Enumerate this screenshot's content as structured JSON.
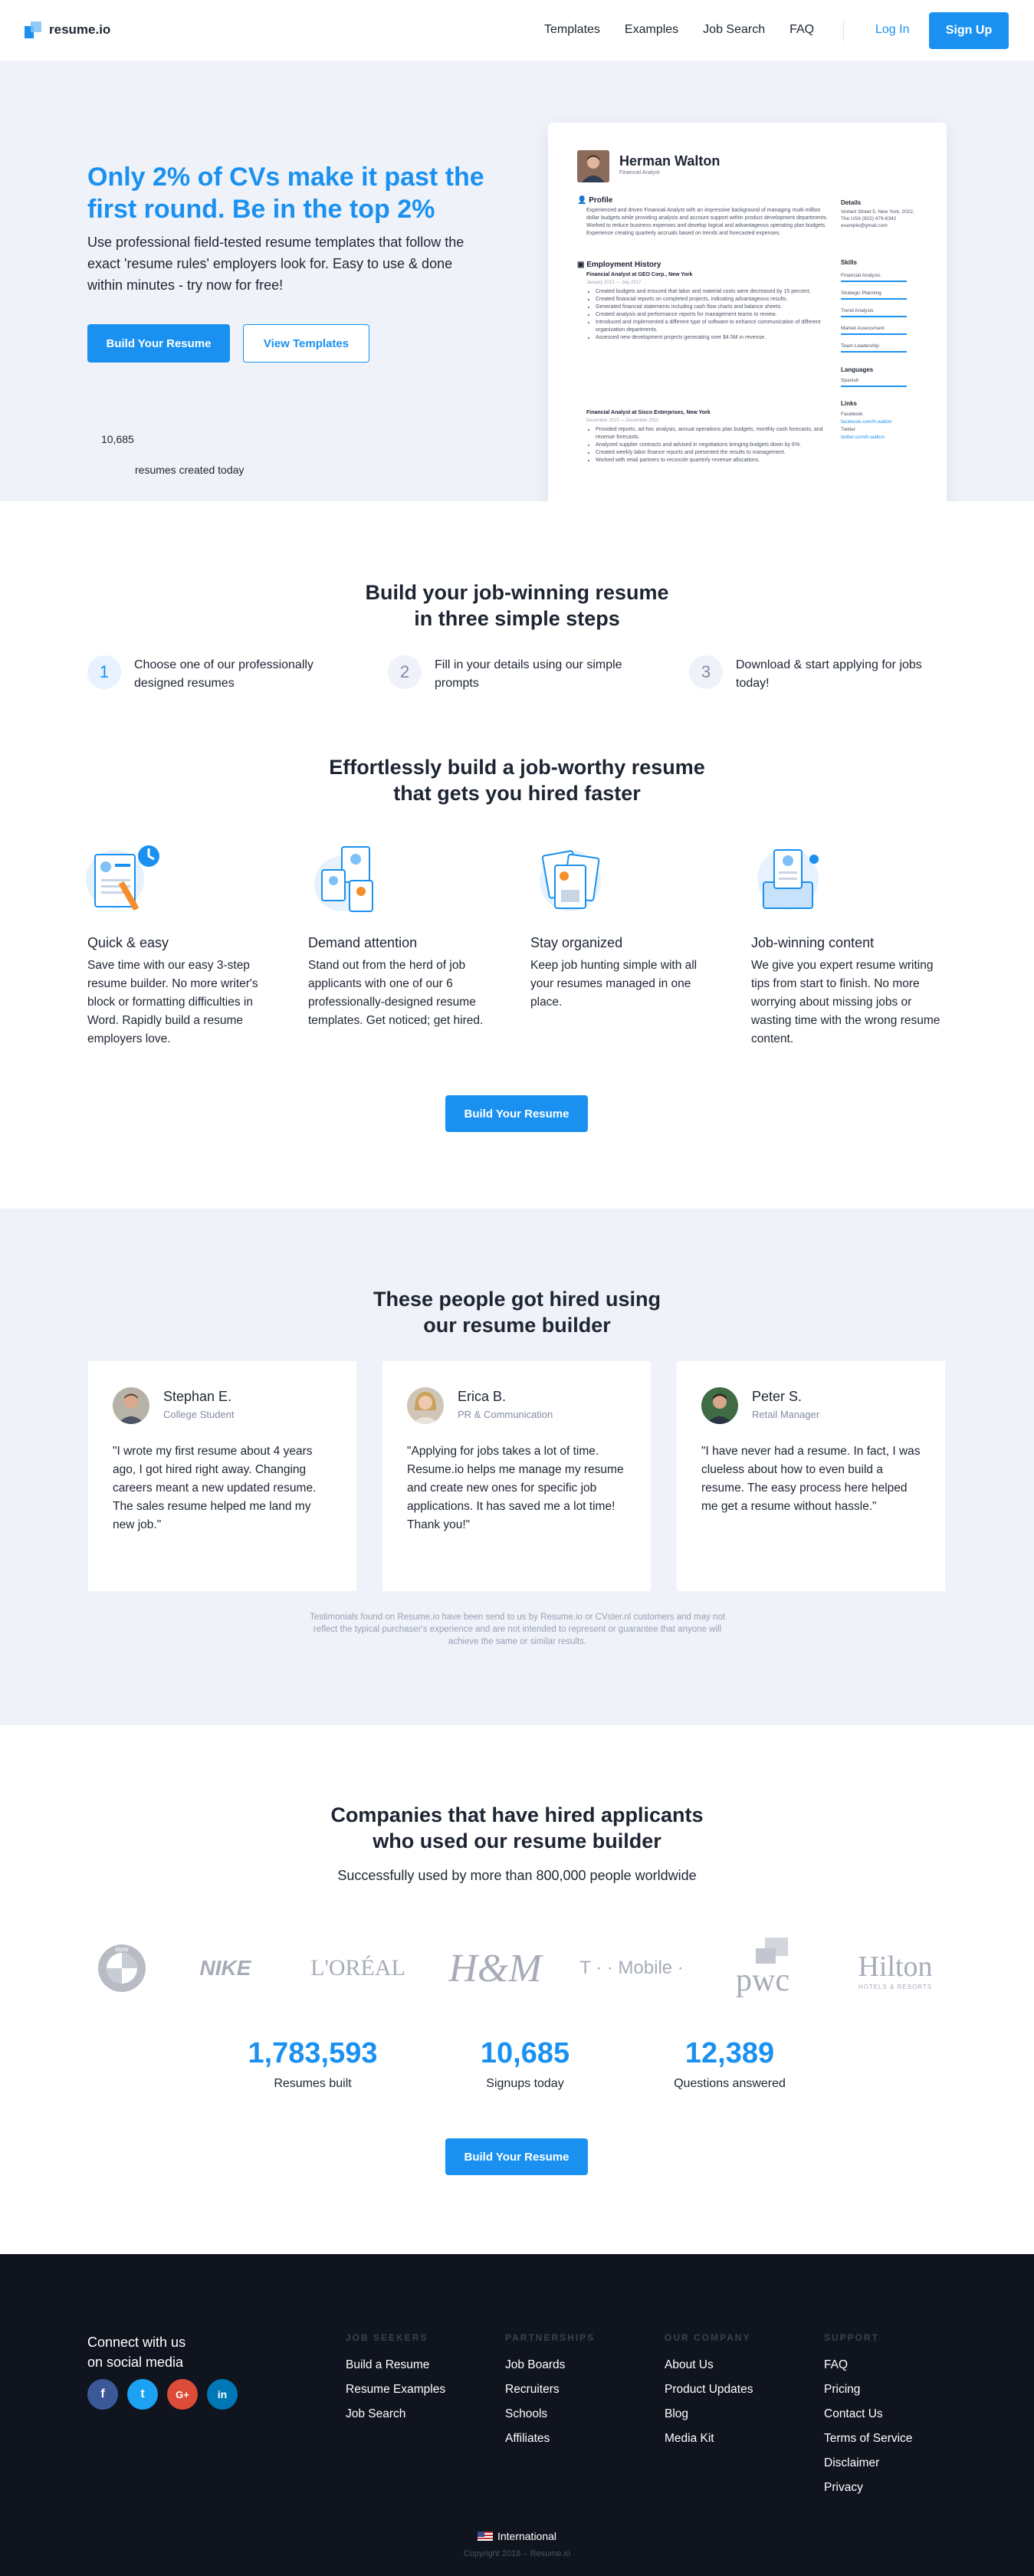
{
  "header": {
    "logo_text": "resume.io",
    "nav": [
      "Templates",
      "Examples",
      "Job Search",
      "FAQ"
    ],
    "login_label": "Log In",
    "signup_label": "Sign Up",
    "accent_color": "#1a91f0"
  },
  "hero": {
    "title": "Only 2% of CVs make it past the first round. Be in the top 2%",
    "subtitle": "Use professional field-tested resume templates that follow the exact 'resume rules' employers look for. Easy to use & done within minutes - try now for free!",
    "primary_button": "Build Your Resume",
    "secondary_button": "View Templates",
    "counter_value": "10,685",
    "counter_label": "resumes created today"
  },
  "resume_preview": {
    "name": "Herman Walton",
    "role": "Financial Analyst",
    "profile_heading": "Profile",
    "profile_text": "Experienced and driven Financial Analyst with an impressive background of managing multi-million dollar budgets while providing analysis and account support within product development departments. Worked to reduce business expenses and develop logical and advantageous operating plan budgets. Experience creating quarterly accruals based on trends and forecasted expenses.",
    "employment_heading": "Employment History",
    "job1_title": "Financial Analyst at GEO Corp., New York",
    "job1_dates": "January 2012 — July 2017",
    "job1_bullets": [
      "Created budgets and ensured that labor and material costs were decreased by 15 percent.",
      "Created financial reports on completed projects, indicating advantageous results.",
      "Generated financial statements including cash flow charts and balance sheets.",
      "Created analysis and performance reports for management teams to review.",
      "Introduced and implemented a different type of software to enhance communication of different organization departments.",
      "Assessed new development projects generating over $4.5M in revenue."
    ],
    "job2_title": "Financial Analyst at Sisco Enterprises, New York",
    "job2_dates": "December 2010 — December 2011",
    "job2_bullets": [
      "Provided reports, ad-hoc analysis, annual operations plan budgets, monthly cash forecasts, and revenue forecasts.",
      "Analyzed supplier contracts and advised in negotiations bringing budgets down by 6%.",
      "Created weekly labor finance reports and presented the results to management.",
      "Worked with retail partners to reconcile quarterly revenue allocations."
    ],
    "details_heading": "Details",
    "details_text": "Vorlant Street 5, New York, 2022, The USA (922) 479-6342 example@gmail.com",
    "skills_heading": "Skills",
    "skills": [
      "Financial Analysis",
      "Strategic Planning",
      "Trend Analysis",
      "Market Assessment",
      "Team Leadership"
    ],
    "languages_heading": "Languages",
    "languages": [
      "Spanish"
    ],
    "links_heading": "Links",
    "links": [
      "Facebook",
      "facebook.com/h.walton",
      "Twitter",
      "twitter.com/h.walton"
    ]
  },
  "steps": {
    "title_line1": "Build your job-winning resume",
    "title_line2": "in three simple steps",
    "items": [
      {
        "num": "1",
        "text": "Choose one of our professionally designed resumes"
      },
      {
        "num": "2",
        "text": "Fill in your details using our simple prompts"
      },
      {
        "num": "3",
        "text": "Download & start applying for jobs today!"
      }
    ]
  },
  "features": {
    "title_line1": "Effortlessly build a job-worthy resume",
    "title_line2": "that gets you hired faster",
    "items": [
      {
        "title": "Quick & easy",
        "text": "Save time with our easy 3-step resume builder. No more writer's block or formatting difficulties in Word. Rapidly build a resume employers love."
      },
      {
        "title": "Demand attention",
        "text": "Stand out from the herd of job applicants with one of our 6 professionally-designed resume templates. Get noticed; get hired."
      },
      {
        "title": "Stay organized",
        "text": "Keep job hunting simple with all your resumes managed in one place."
      },
      {
        "title": "Job-winning content",
        "text": "We give you expert resume writing tips from start to finish. No more worrying about missing jobs or wasting time with the wrong resume content."
      }
    ],
    "button": "Build Your Resume"
  },
  "testimonials": {
    "title_line1": "These people got hired using",
    "title_line2": "our resume builder",
    "items": [
      {
        "name": "Stephan E.",
        "role": "College Student",
        "quote": "\"I wrote my first resume about 4 years ago, I got hired right away. Changing careers meant a new updated resume. The sales resume helped me land my new job.\""
      },
      {
        "name": "Erica B.",
        "role": "PR & Communication",
        "quote": "\"Applying for jobs takes a lot of time. Resume.io helps me manage my resume and create new ones for specific job applications. It has saved me a lot time! Thank you!\""
      },
      {
        "name": "Peter S.",
        "role": "Retail Manager",
        "quote": "\"I have never had a resume. In fact, I was clueless about how to even build a resume. The easy process here helped me get a resume without hassle.\""
      }
    ],
    "disclaimer": "Testimonials found on Resume.io have been send to us by Resume.io or CVster.nl customers and may not reflect the typical purchaser's experience and are not intended to represent or guarantee that anyone will achieve the same or similar results."
  },
  "companies": {
    "title_line1": "Companies that have hired applicants",
    "title_line2": "who used our resume builder",
    "subtitle": "Successfully used by more than 800,000 people worldwide",
    "logos": [
      "BMW",
      "NIKE",
      "L'ORÉAL",
      "H&M",
      "T · · Mobile ·",
      "pwc",
      "Hilton",
      "HOTELS & RESORTS"
    ],
    "stats": [
      {
        "value": "1,783,593",
        "label": "Resumes built"
      },
      {
        "value": "10,685",
        "label": "Signups today"
      },
      {
        "value": "12,389",
        "label": "Questions answered"
      }
    ],
    "button": "Build Your Resume"
  },
  "footer": {
    "connect_line1": "Connect with us",
    "connect_line2": "on social media",
    "social": [
      "f",
      "t",
      "G+",
      "in"
    ],
    "columns": [
      {
        "heading": "JOB SEEKERS",
        "links": [
          "Build a Resume",
          "Resume Examples",
          "Job Search"
        ]
      },
      {
        "heading": "PARTNERSHIPS",
        "links": [
          "Job Boards",
          "Recruiters",
          "Schools",
          "Affiliates"
        ]
      },
      {
        "heading": "OUR COMPANY",
        "links": [
          "About Us",
          "Product Updates",
          "Blog",
          "Media Kit"
        ]
      },
      {
        "heading": "SUPPORT",
        "links": [
          "FAQ",
          "Pricing",
          "Contact Us",
          "Terms of Service",
          "Disclaimer",
          "Privacy"
        ]
      }
    ],
    "international": "International",
    "copyright": "Copyright 2018 – Resume.io"
  }
}
